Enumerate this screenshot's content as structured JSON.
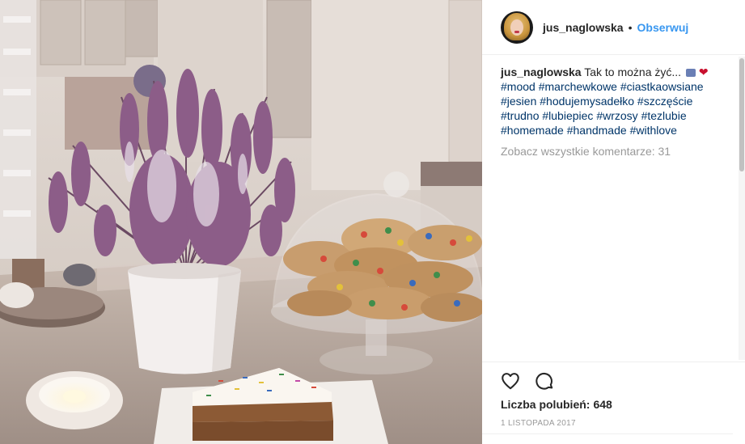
{
  "post": {
    "username": "jus_naglowska",
    "separator": "•",
    "follow_label": "Obserwuj",
    "caption": {
      "username": "jus_naglowska",
      "text": "Tak to można żyć...",
      "emoji_heart": "❤",
      "hashtags": [
        "#mood",
        "#marchewkowe",
        "#ciastkaowsiane",
        "#jesien",
        "#hodujemysadełko",
        "#szczęście",
        "#trudno",
        "#lubiepiec",
        "#wrzosy",
        "#tezlubie",
        "#homemade",
        "#handmade",
        "#withlove"
      ]
    },
    "view_all_comments": "Zobacz wszystkie komentarze: 31",
    "likes_label": "Liczba polubień:",
    "likes_count": "648",
    "date": "1 LISTOPADA 2017"
  },
  "icons": {
    "like": "heart-outline-icon",
    "comment": "speech-bubble-icon"
  },
  "colors": {
    "link_blue": "#3897f0",
    "hashtag": "#003569",
    "muted": "#999999",
    "text": "#262626"
  }
}
